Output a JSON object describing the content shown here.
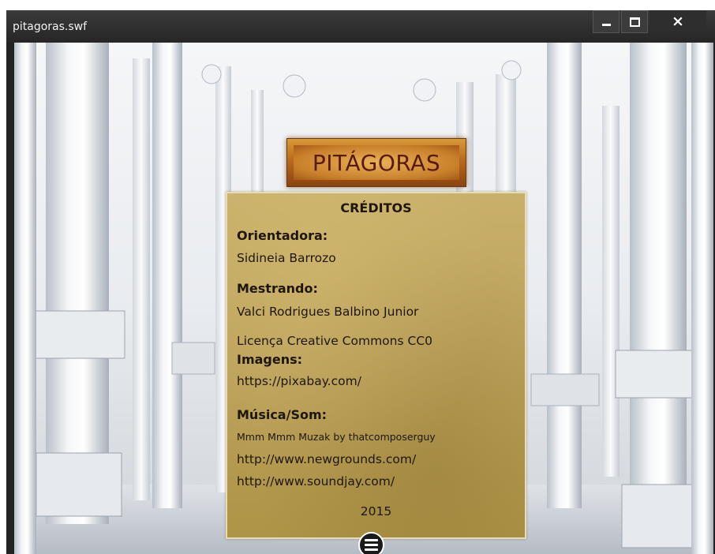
{
  "window": {
    "title": "pitagoras.swf",
    "controls": {
      "minimize": "minimize-icon",
      "maximize": "maximize-icon",
      "close": "×"
    }
  },
  "banner": {
    "text": "PITÁGORAS"
  },
  "credits": {
    "heading": "CRÉDITOS",
    "orientadora_label": "Orientadora:",
    "orientadora_value": "Sidineia Barrozo",
    "mestrando_label": "Mestrando:",
    "mestrando_value": "Valci Rodrigues Balbino Junior",
    "license": "Licença Creative Commons CC0",
    "imagens_label": "Imagens:",
    "imagens_value": "https://pixabay.com/",
    "musica_label": "Música/Som:",
    "musica_value": "Mmm Mmm Muzak by thatcomposerguy",
    "link_1": "http://www.newgrounds.com/",
    "link_2": "http://www.soundjay.com/",
    "year": "2015"
  },
  "menu_button": {
    "icon": "hamburger-menu-icon"
  },
  "colors": {
    "title_bar": "#2b2b2b",
    "parchment": "#bfa55c",
    "banner": "#c27a26",
    "banner_text": "#5a1a08"
  }
}
